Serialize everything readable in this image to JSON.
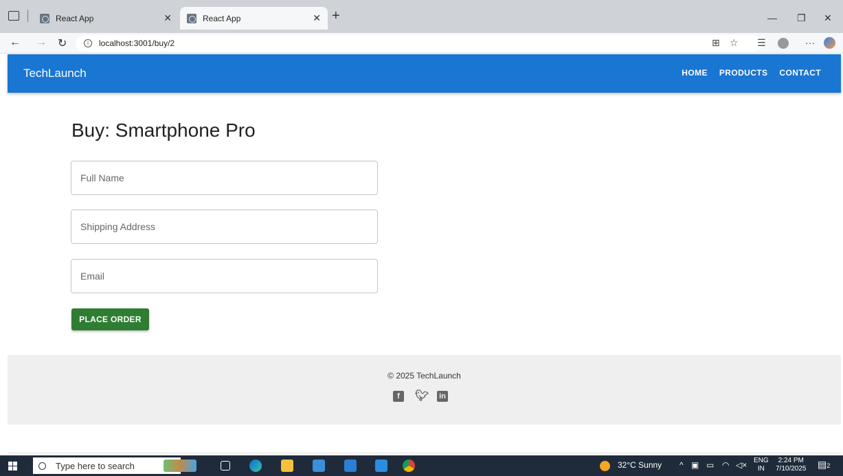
{
  "browser": {
    "tabs": [
      {
        "title": "React App"
      },
      {
        "title": "React App"
      }
    ],
    "new_tab_label": "+",
    "url": "localhost:3001/buy/2"
  },
  "app": {
    "brand": "TechLaunch",
    "nav": [
      "HOME",
      "PRODUCTS",
      "CONTACT"
    ],
    "page_title": "Buy: Smartphone Pro",
    "form": {
      "name_placeholder": "Full Name",
      "address_placeholder": "Shipping Address",
      "email_placeholder": "Email",
      "submit_label": "PLACE ORDER"
    },
    "footer": {
      "copyright": "© 2025 TechLaunch",
      "socials": [
        "facebook-icon",
        "twitter-icon",
        "linkedin-icon"
      ]
    },
    "colors": {
      "appbar": "#1976d2",
      "button": "#2e7d32",
      "footer": "#efefef"
    }
  },
  "taskbar": {
    "search_placeholder": "Type here to search",
    "weather": "32°C  Sunny",
    "lang_top": "ENG",
    "lang_bottom": "IN",
    "time": "2:24 PM",
    "date": "7/10/2025",
    "notification_count": "2"
  }
}
